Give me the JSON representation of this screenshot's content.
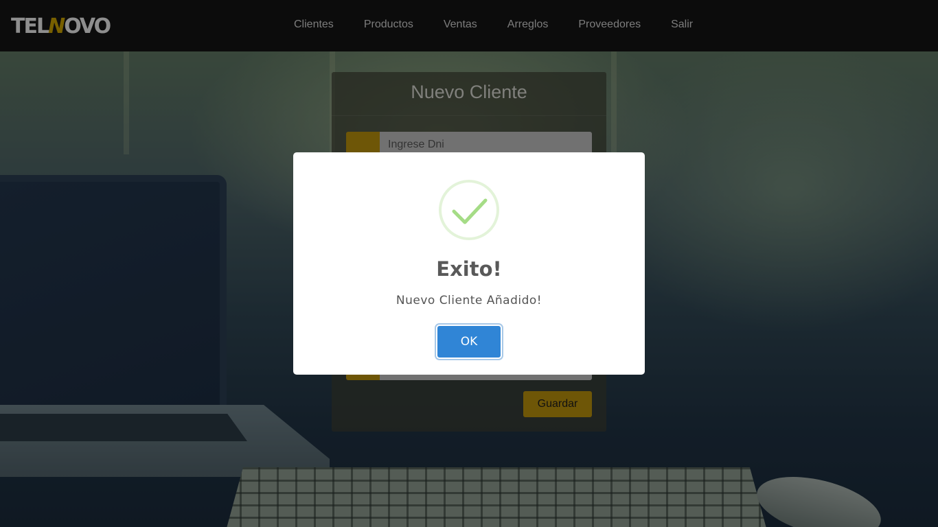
{
  "navbar": {
    "logo_left": "TEL",
    "logo_accent": "N",
    "logo_right": "OVO",
    "links": [
      "Clientes",
      "Productos",
      "Ventas",
      "Arreglos",
      "Proveedores",
      "Salir"
    ]
  },
  "form": {
    "title": "Nuevo Cliente",
    "dni_placeholder": "Ingrese Dni",
    "save_label": "Guardar"
  },
  "modal": {
    "icon": "success-check-icon",
    "title": "Exito!",
    "message": "Nuevo Cliente Añadido!",
    "ok_label": "OK"
  },
  "colors": {
    "accent": "#b8900c",
    "ok_button": "#3085d6",
    "check": "#a5dc86",
    "navbar": "#141414"
  }
}
